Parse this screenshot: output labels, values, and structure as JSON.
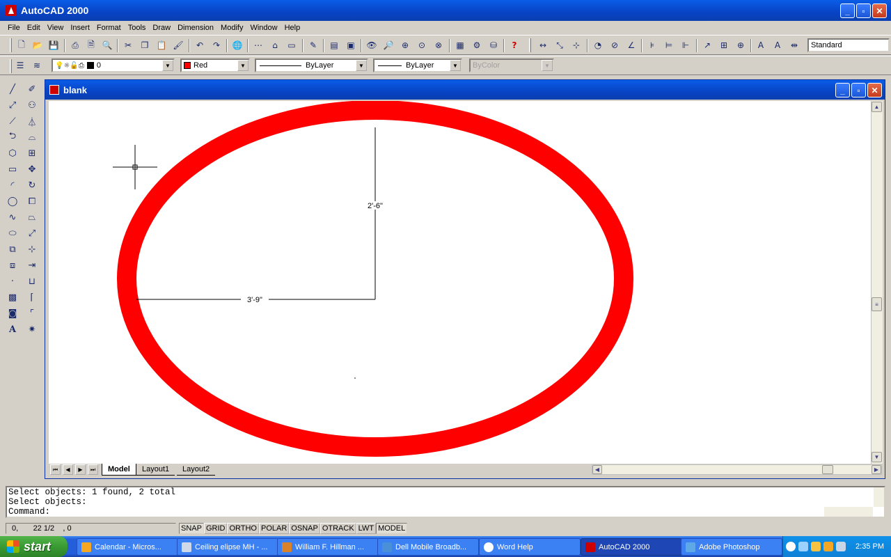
{
  "app": {
    "title": "AutoCAD 2000"
  },
  "menu": [
    "File",
    "Edit",
    "View",
    "Insert",
    "Format",
    "Tools",
    "Draw",
    "Dimension",
    "Modify",
    "Window",
    "Help"
  ],
  "toolbar": {
    "text_style": "Standard"
  },
  "properties": {
    "layer": "0",
    "color": "Red",
    "color_hex": "#ff0000",
    "linetype": "ByLayer",
    "lineweight": "ByLayer",
    "plotstyle": "ByColor"
  },
  "drawing": {
    "title": "blank",
    "dim_vertical": "2'-6\"",
    "dim_horizontal": "3'-9\"",
    "ellipse_color": "#ff0000",
    "tabs": [
      "Model",
      "Layout1",
      "Layout2"
    ],
    "active_tab": "Model"
  },
  "command": {
    "lines": [
      "Select objects: 1 found, 2 total",
      "Select objects:",
      "Command:"
    ]
  },
  "status": {
    "coords": "0,       22 1/2    , 0",
    "buttons": [
      "SNAP",
      "GRID",
      "ORTHO",
      "POLAR",
      "OSNAP",
      "OTRACK",
      "LWT",
      "MODEL"
    ]
  },
  "taskbar": {
    "start": "start",
    "tasks": [
      {
        "label": "Calendar - Micros...",
        "icon": "outlook-icon",
        "color": "#f5a623"
      },
      {
        "label": "Ceiling elipse MH - ...",
        "icon": "document-icon",
        "color": "#cfd8e8"
      },
      {
        "label": "William F. Hillman ...",
        "icon": "browser-icon",
        "color": "#d9822b"
      },
      {
        "label": "Dell Mobile Broadb...",
        "icon": "network-icon",
        "color": "#4a90d9"
      },
      {
        "label": "Word Help",
        "icon": "help-icon",
        "color": "#ffffff"
      },
      {
        "label": "AutoCAD 2000",
        "icon": "autocad-icon",
        "color": "#cc0000"
      },
      {
        "label": "Adobe Photoshop",
        "icon": "photoshop-icon",
        "color": "#5fa8e8"
      }
    ],
    "clock": "2:35 PM"
  }
}
